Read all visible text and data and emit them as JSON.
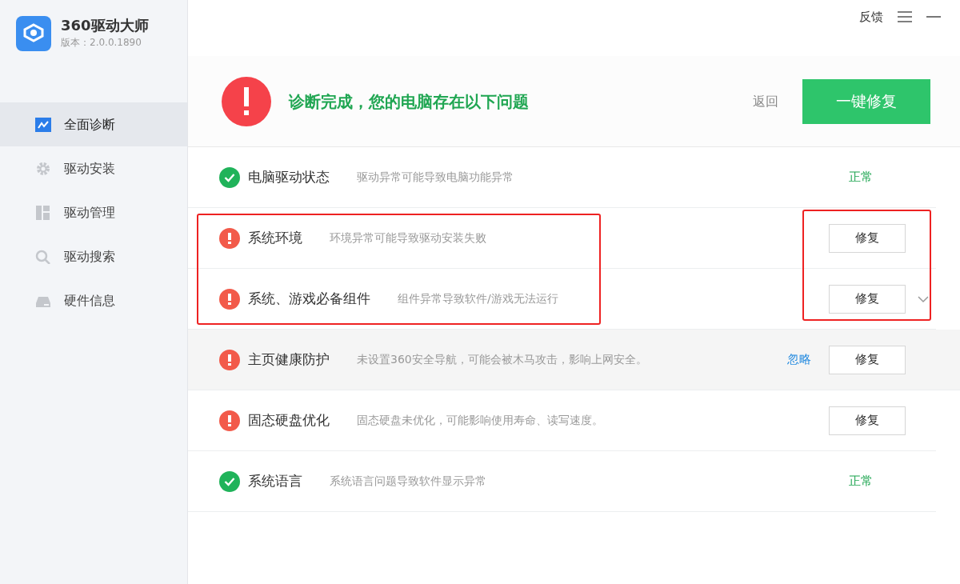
{
  "app": {
    "name": "360驱动大师",
    "version": "版本：2.0.0.1890"
  },
  "window_controls": {
    "feedback": "反馈"
  },
  "sidebar": {
    "items": [
      {
        "label": "全面诊断",
        "selected": true
      },
      {
        "label": "驱动安装",
        "selected": false
      },
      {
        "label": "驱动管理",
        "selected": false
      },
      {
        "label": "驱动搜索",
        "selected": false
      },
      {
        "label": "硬件信息",
        "selected": false
      }
    ]
  },
  "header": {
    "message": "诊断完成，您的电脑存在以下问题",
    "back": "返回",
    "fix_all": "一键修复"
  },
  "rows": [
    {
      "kind": "ok",
      "title": "电脑驱动状态",
      "description": "驱动异常可能导致电脑功能异常",
      "status": "正常"
    },
    {
      "kind": "issue",
      "title": "系统环境",
      "description": "环境异常可能导致驱动安装失败",
      "button": "修复",
      "annotated": true
    },
    {
      "kind": "issue",
      "title": "系统、游戏必备组件",
      "description": "组件异常导致软件/游戏无法运行",
      "button": "修复",
      "expandable": true,
      "annotated": true
    },
    {
      "kind": "issue",
      "title": "主页健康防护",
      "description": "未设置360安全导航，可能会被木马攻击，影响上网安全。",
      "ignore": "忽略",
      "button": "修复",
      "hovered": true
    },
    {
      "kind": "issue",
      "title": "固态硬盘优化",
      "description": "固态硬盘未优化，可能影响使用寿命、读写速度。",
      "button": "修复"
    },
    {
      "kind": "ok",
      "title": "系统语言",
      "description": "系统语言问题导致软件显示异常",
      "status": "正常"
    }
  ]
}
